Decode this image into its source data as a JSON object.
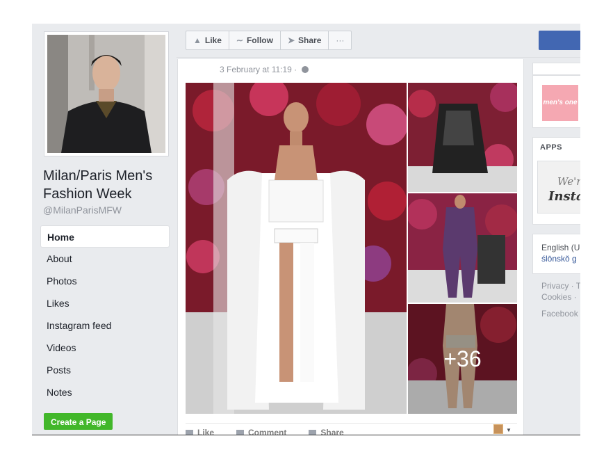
{
  "page": {
    "name": "Milan/Paris Men's Fashion Week",
    "handle": "@MilanParisMFW"
  },
  "nav": {
    "items": [
      {
        "label": "Home",
        "active": true
      },
      {
        "label": "About"
      },
      {
        "label": "Photos"
      },
      {
        "label": "Likes"
      },
      {
        "label": "Instagram feed"
      },
      {
        "label": "Videos"
      },
      {
        "label": "Posts"
      },
      {
        "label": "Notes"
      }
    ],
    "create_page": "Create a Page"
  },
  "actions": {
    "like": "Like",
    "follow": "Follow",
    "share": "Share",
    "more": "···"
  },
  "post": {
    "timestamp": "3 February at 11:19 ·",
    "more_photos": "+36",
    "like": "Like",
    "comment": "Comment",
    "share": "Share"
  },
  "right": {
    "logo_text": "men's one",
    "apps_title": "APPS",
    "apps_line1": "We're",
    "apps_line2": "Instag",
    "lang_current": "English (U",
    "lang_alt": "ślōnskŏ g",
    "footer1": "Privacy · Te",
    "footer2": "Cookies ·",
    "footer3": "Facebook"
  },
  "colors": {
    "brand_blue": "#4267b2",
    "create_green": "#42b72a",
    "background": "#e9ebee"
  },
  "icons": [
    "thumbs-up-icon",
    "rss-icon",
    "share-arrow-icon",
    "globe-icon"
  ]
}
